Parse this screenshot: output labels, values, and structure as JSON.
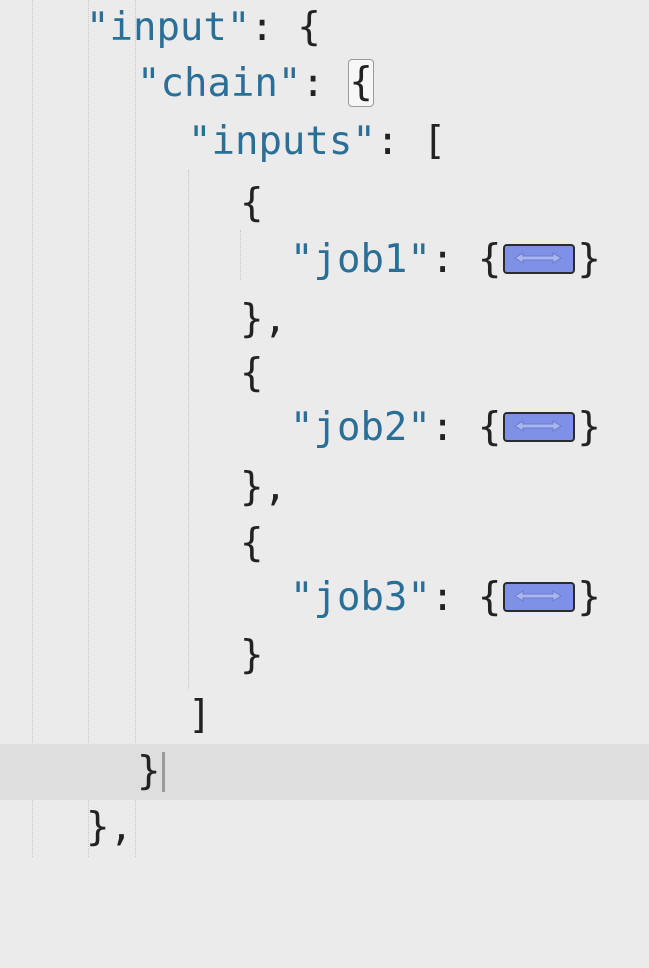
{
  "editor": {
    "language": "json",
    "colors": {
      "background": "#ebebeb",
      "current_line": "#dedede",
      "key": "#2a6f97",
      "punctuation": "#222222",
      "fold_marker": "#7f91e6"
    },
    "lines": [
      {
        "key": "\"input\"",
        "after": ": {"
      },
      {
        "key": "\"chain\"",
        "after": ": ",
        "matched_bracket": "{"
      },
      {
        "key": "\"inputs\"",
        "after": ": ["
      },
      {
        "text": "{"
      },
      {
        "key": "\"job1\"",
        "after": ": ",
        "fold_open": "{",
        "fold_close": "}",
        "fold_icon": "double-arrow-icon"
      },
      {
        "text": "},"
      },
      {
        "text": "{"
      },
      {
        "key": "\"job2\"",
        "after": ": ",
        "fold_open": "{",
        "fold_close": "}",
        "fold_icon": "double-arrow-icon"
      },
      {
        "text": "},"
      },
      {
        "text": "{"
      },
      {
        "key": "\"job3\"",
        "after": ": ",
        "fold_open": "{",
        "fold_close": "}",
        "fold_icon": "double-arrow-icon"
      },
      {
        "text": "}"
      },
      {
        "text": "]"
      },
      {
        "text": "}",
        "current": true
      },
      {
        "text": "},"
      }
    ]
  }
}
